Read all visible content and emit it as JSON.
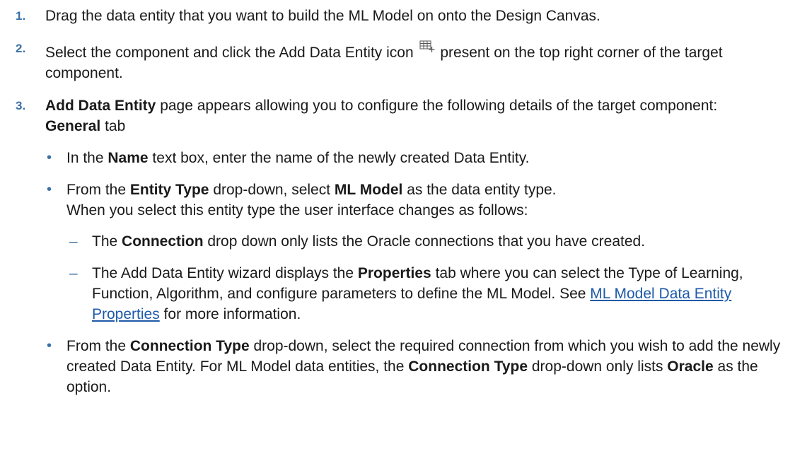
{
  "steps": [
    {
      "num": "1.",
      "text": "Drag the data entity that you want to build the ML Model on onto the Design Canvas."
    },
    {
      "num": "2.",
      "text_before_icon": "Select the component and click the Add Data Entity icon",
      "icon": "add-data-entity-icon",
      "text_after_icon": "present on the top right corner of the target component."
    },
    {
      "num": "3.",
      "bold_start": "Add Data Entity",
      "text": "page appears allowing you to configure the following details of the target component:",
      "tab_bold": "General",
      "tab_suffix": "tab",
      "bullets": [
        {
          "t1": "In the ",
          "b1": "Name",
          "t2": " text box, enter the name of the newly created Data Entity."
        },
        {
          "t1": "From the ",
          "b1": "Entity Type",
          "t2": " drop-down, select ",
          "b2": "ML Model",
          "t3": " as the data entity type.",
          "line2": "When you select this entity type the user interface changes as follows:",
          "subitems": [
            {
              "dash": "–",
              "t1": "The ",
              "b1": "Connection",
              "t2": " drop down only lists the Oracle connections that you have created."
            },
            {
              "dash": "–",
              "t1": "The Add Data Entity wizard displays the ",
              "b1": "Properties",
              "t2": " tab where you can select the Type of Learning, Function, Algorithm, and configure parameters to define the ML Model. See ",
              "link": "ML Model Data Entity Properties",
              "t3": " for more information."
            }
          ]
        },
        {
          "t1": "From the ",
          "b1": "Connection Type",
          "t2": " drop-down, select the required connection from which you wish to add the newly created Data Entity. For ML Model data entities, the ",
          "b2": "Connection Type",
          "t3": " drop-down only lists ",
          "b3": "Oracle",
          "t4": " as the option."
        }
      ]
    }
  ],
  "colors": {
    "number": "#3a70a6",
    "link": "#1e5aa8",
    "text": "#1a1a1a"
  }
}
